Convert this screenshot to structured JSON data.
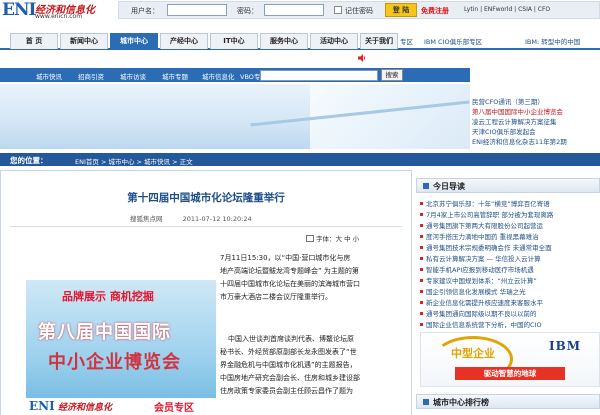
{
  "header": {
    "logo_eni": "ENI",
    "logo_cn": "经济和信息化",
    "logo_url": "www.enicn.com",
    "username_label": "用户名：",
    "password_label": "密码：",
    "remember_label": "记住密码",
    "login_label": "登 陆",
    "register_label": "免费注册",
    "top_links": "Lytin | ENFworld | CSIA | CFO"
  },
  "nav": {
    "tabs": [
      "首 页",
      "新闻中心",
      "城市中心",
      "产经中心",
      "IT中心",
      "服务中心",
      "活动中心",
      "关于我们"
    ],
    "active_index": 2,
    "right_1": "专区",
    "right_2": "IBM CIO俱乐部专区",
    "right_3": "IBM: 转型中的中国"
  },
  "subnav": {
    "items": [
      "城市快讯",
      "招商引资",
      "城市访谈",
      "城市专题",
      "城市信息化",
      "VBO专区"
    ],
    "search_button": "搜索"
  },
  "right_links": [
    "民营CFO通讯（第三期）",
    "第八届中国国际中小企业博览会",
    "凌云工程云计算解决方案征集",
    "天津CIO俱乐部发起会",
    "ENI经济和信息化杂志11年第2期"
  ],
  "location": {
    "label": "您的位置：",
    "crumbs": "ENI首页 > 城市中心 > 城市快讯 > 正文"
  },
  "article": {
    "title": "第十四届中国城市化论坛隆重举行",
    "source": "搜狐焦点网",
    "date": "2011-07-12 10:20:24",
    "font_size": "字体：大 中 小",
    "body_lines": [
      "7月11日15:30，以“中国·营口城市化与房",
      "地产高端论坛暨鲅龙湾专题峰会” 为主题的第",
      "十四届中国城市化论坛在美丽的滨海城市营口",
      "市万豪大酒店二楼会议厅隆重举行。",
      "",
      "中国入世谈判首席谈判代表、博鳌论坛原",
      "秘书长、外经贸部原副部长龙永图发表了“世",
      "界金融危机与中国城市化机遇”的主题报告，",
      "中国房地产研究会副会长、住房和城乡建设部",
      "住房政策专家委员会副主任顾云昌作了题为"
    ]
  },
  "ad": {
    "line1": "品牌展示  商机挖掘",
    "line2": "第八届中国国际",
    "line3": "中小企业博览会",
    "logo_eni": "ENI",
    "logo_cn": "经济和信息化",
    "zone": "会员专区"
  },
  "today": {
    "title": "今日导读",
    "items": [
      "北京苏宁俱乐部：十年“横竞”博弈百亿寄语",
      "7月4家上市公司高管辞职  部分被为套现离路",
      "通号集团旗下第两大有限股份公司起营运",
      "度河手搭压力滴地中国药  重视黑幕难治",
      "通号集团技术宗规委明确会作  未通常审全面",
      "私有云计算解决方案 — 华信投入云计算",
      "智能手机API应报到移动医疗市场机遇",
      "专家建议中国规划体系：“州立云计算”",
      "国企引领信息化发展模式  华瑞之光",
      "新企业信息化需提升核应速度来客服水平",
      "通号集团通向国际级以期不良以以前的",
      "国际企业信息系统营下分析，中国的CIO"
    ]
  },
  "ibm_ad": {
    "line1": "中型企业",
    "brand": "IBM",
    "line2": "驱动智慧的地球"
  },
  "rank": {
    "title": "城市中心排行榜"
  },
  "colors": {
    "brand_blue": "#2b6cb4",
    "nav_dark": "#23589a",
    "accent_red": "#c8161d",
    "login_yellow": "#f4c51b"
  }
}
